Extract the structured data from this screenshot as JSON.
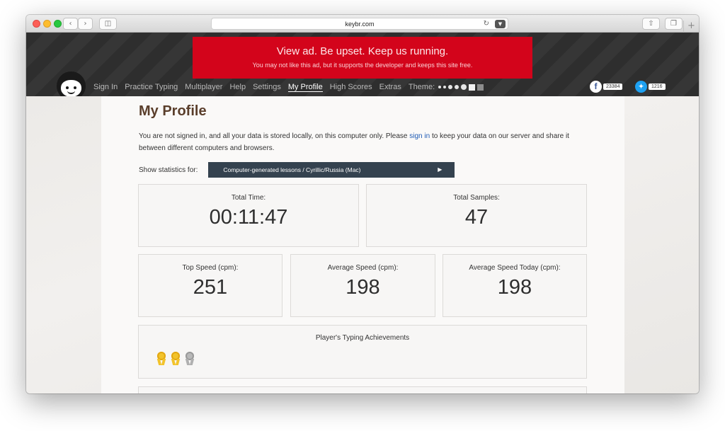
{
  "browser": {
    "url": "keybr.com",
    "icons": [
      "back-icon",
      "forward-icon",
      "sidebar-icon",
      "reload-icon",
      "pocket-icon",
      "share-icon",
      "tabs-icon",
      "new-tab-icon"
    ]
  },
  "ad": {
    "title": "View ad. Be upset. Keep us running.",
    "subtitle": "You may not like this ad, but it supports the developer and keeps this site free."
  },
  "nav": {
    "items": [
      "Sign In",
      "Practice Typing",
      "Multiplayer",
      "Help",
      "Settings",
      "My Profile",
      "High Scores",
      "Extras"
    ],
    "active": "My Profile",
    "theme_label": "Theme:"
  },
  "social": {
    "facebook_count": "23384",
    "twitter_count": "1216"
  },
  "profile": {
    "title": "My Profile",
    "notice_before": "You are not signed in, and all your data is stored locally, on this computer only. Please ",
    "notice_link": "sign in",
    "notice_after": " to keep your data on our server and share it between different computers and browsers.",
    "stats_label": "Show statistics for:",
    "stats_selected": "Computer-generated lessons / Cyrillic/Russia (Mac)"
  },
  "stats": {
    "total_time_label": "Total Time:",
    "total_time": "00:11:47",
    "total_samples_label": "Total Samples:",
    "total_samples": "47",
    "top_speed_label": "Top Speed (cpm):",
    "top_speed": "251",
    "avg_speed_label": "Average Speed (cpm):",
    "avg_speed": "198",
    "avg_today_label": "Average Speed Today (cpm):",
    "avg_today": "198"
  },
  "achievements": {
    "title": "Player's Typing Achievements",
    "medals": [
      "gold",
      "gold",
      "silver"
    ]
  },
  "colors": {
    "ad_red": "#d3041b",
    "header_dark": "#2e2e2e",
    "select_bg": "#34424f",
    "link_blue": "#1e5ab4",
    "title_brown": "#5a3e2b"
  }
}
